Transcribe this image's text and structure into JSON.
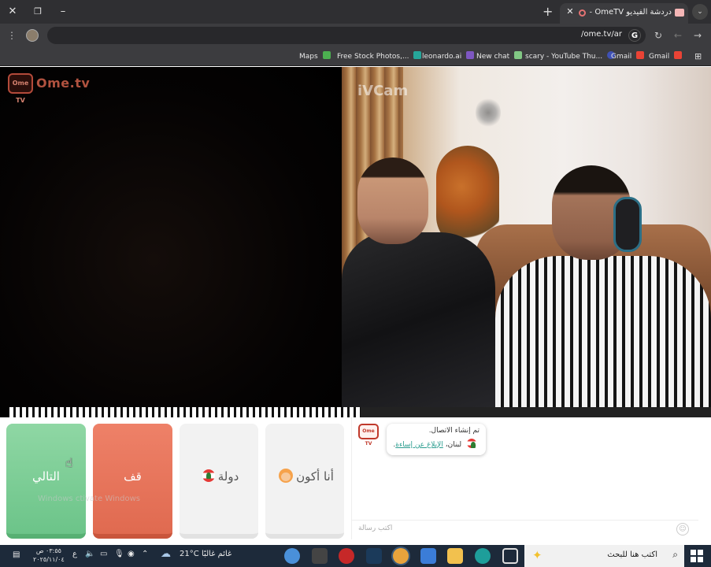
{
  "browser": {
    "tab_title": "دردشة الفيديو OmeTV — بد",
    "tab_close": "✕",
    "new_tab": "+",
    "tab_menu": "⌄",
    "url": "ome.tv/ar/",
    "url_prefix_icon": "G"
  },
  "bookmarks": [
    {
      "label": "Maps",
      "icon": "maps-icon"
    },
    {
      "label": "Free Stock Photos,...",
      "icon": "photos-icon"
    },
    {
      "label": "leonardo.ai",
      "icon": "leonardo-icon"
    },
    {
      "label": "New chat",
      "icon": "chat-icon"
    },
    {
      "label": "scary - YouTube Thu...",
      "icon": "youtube-icon"
    },
    {
      "label": "Gmail",
      "icon": "gmail-icon"
    },
    {
      "label": "Gmail",
      "icon": "gmail-icon"
    }
  ],
  "page": {
    "logo_badge": "Ome TV",
    "logo_text": "Ome.tv",
    "watermark": "iVCam",
    "buttons": {
      "next": "التالي",
      "stop": "قف",
      "country": "دولة",
      "me": "أنا أكون"
    },
    "chat": {
      "logo": "Ome TV",
      "message_line1": "تم إنشاء الاتصال.",
      "country": "لبنان",
      "report": "الإبلاغ عن إساءة",
      "input_placeholder": "اكتب رسالة"
    },
    "windows_activation": "Windows ctivate Windows"
  },
  "taskbar": {
    "time": "٠٣:٥٥ ص",
    "date": "٢٠٢٥/١١/٠٤",
    "lang": "ع",
    "temperature": "21°C",
    "weather": "غائم غالبًا",
    "search_placeholder": "اكتب هنا للبحث"
  },
  "colors": {
    "next": "#6cc489",
    "stop": "#e06a50",
    "accent": "#2a9d8f"
  }
}
